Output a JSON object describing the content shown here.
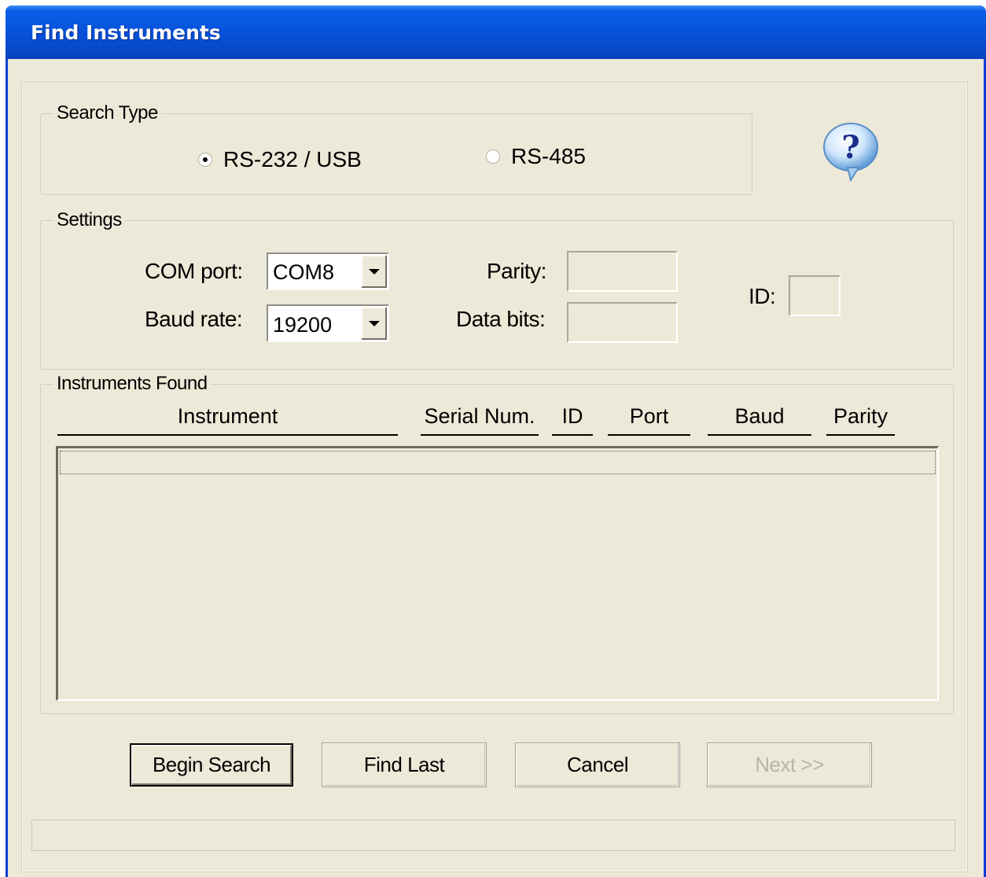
{
  "window": {
    "title": "Find Instruments"
  },
  "search_type": {
    "label": "Search Type",
    "options": [
      {
        "label": "RS-232 / USB",
        "checked": true
      },
      {
        "label": "RS-485",
        "checked": false
      }
    ]
  },
  "help": {
    "icon": "help-balloon-icon"
  },
  "settings": {
    "label": "Settings",
    "com_port_label": "COM port:",
    "com_port_value": "COM8",
    "baud_rate_label": "Baud rate:",
    "baud_rate_value": "19200",
    "parity_label": "Parity:",
    "parity_value": "",
    "data_bits_label": "Data bits:",
    "data_bits_value": "",
    "id_label": "ID:",
    "id_value": ""
  },
  "instruments_found": {
    "label": "Instruments Found",
    "columns": [
      "Instrument",
      "Serial Num.",
      "ID",
      "Port",
      "Baud",
      "Parity"
    ],
    "rows": []
  },
  "buttons": {
    "begin_search": "Begin Search",
    "find_last": "Find Last",
    "cancel": "Cancel",
    "next": "Next >>"
  },
  "status": ""
}
